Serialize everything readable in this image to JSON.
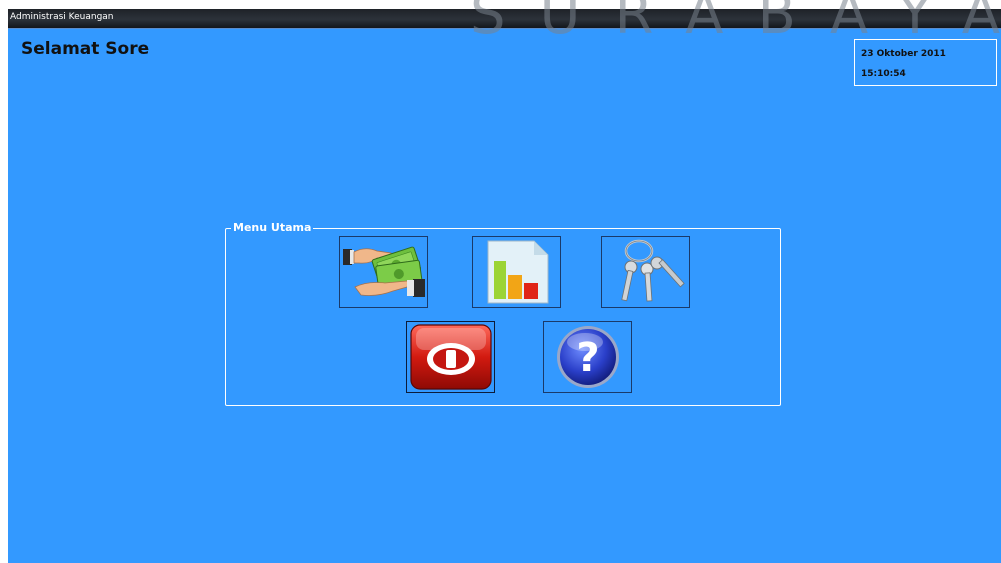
{
  "watermark": "SURABAYA",
  "window": {
    "title": "Administrasi Keuangan"
  },
  "greeting": "Selamat Sore",
  "datetime": {
    "date": "23 Oktober 2011",
    "time": "15:10:54"
  },
  "menu": {
    "legend": "Menu Utama",
    "buttons": [
      {
        "id": "keuangan",
        "icon": "money-hands-icon"
      },
      {
        "id": "laporan",
        "icon": "bar-chart-report-icon"
      },
      {
        "id": "kunci",
        "icon": "keys-icon"
      },
      {
        "id": "keluar",
        "icon": "power-off-icon"
      },
      {
        "id": "bantuan",
        "icon": "help-icon"
      }
    ]
  },
  "colors": {
    "background": "#3399ff",
    "titlebar": "#23272d",
    "border": "#ffffff"
  }
}
